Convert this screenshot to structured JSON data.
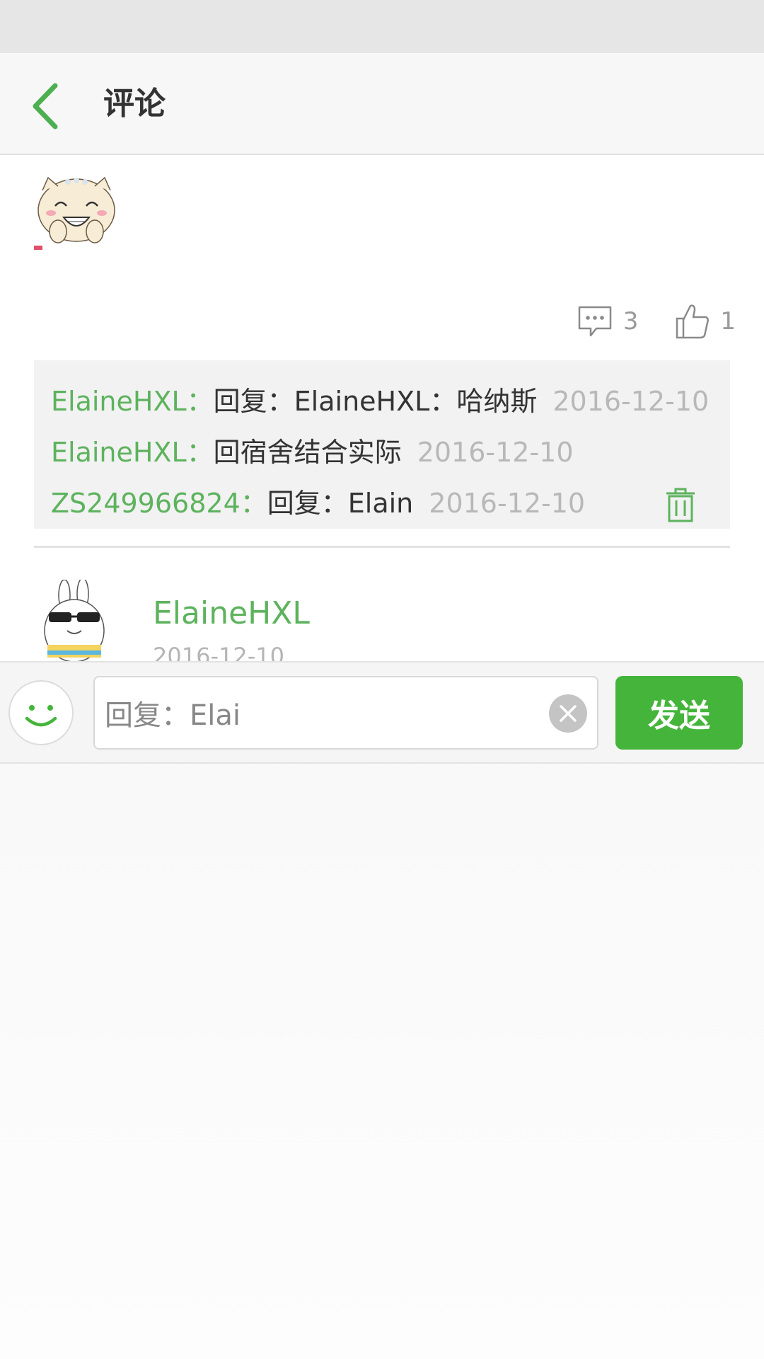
{
  "header": {
    "title": "评论"
  },
  "post": {
    "comment_count": "3",
    "like_count": "1",
    "replies": [
      {
        "user": "ElaineHXL",
        "colon": "：",
        "text": "回复：ElaineHXL：哈纳斯",
        "date": "2016-12-10",
        "deletable": false
      },
      {
        "user": "ElaineHXL",
        "colon": "：",
        "text": "回宿舍结合实际",
        "date": "2016-12-10",
        "deletable": false
      },
      {
        "user": "ZS249966824",
        "colon": "：",
        "text": "回复：Elain",
        "date": "2016-12-10",
        "deletable": true
      }
    ]
  },
  "next_item": {
    "user": "ElaineHXL",
    "date": "2016-12-10"
  },
  "input_bar": {
    "value": "回复：Elai",
    "send_label": "发送"
  },
  "colors": {
    "accent": "#44b53a",
    "username": "#5db35d",
    "date": "#b8b8b8"
  }
}
